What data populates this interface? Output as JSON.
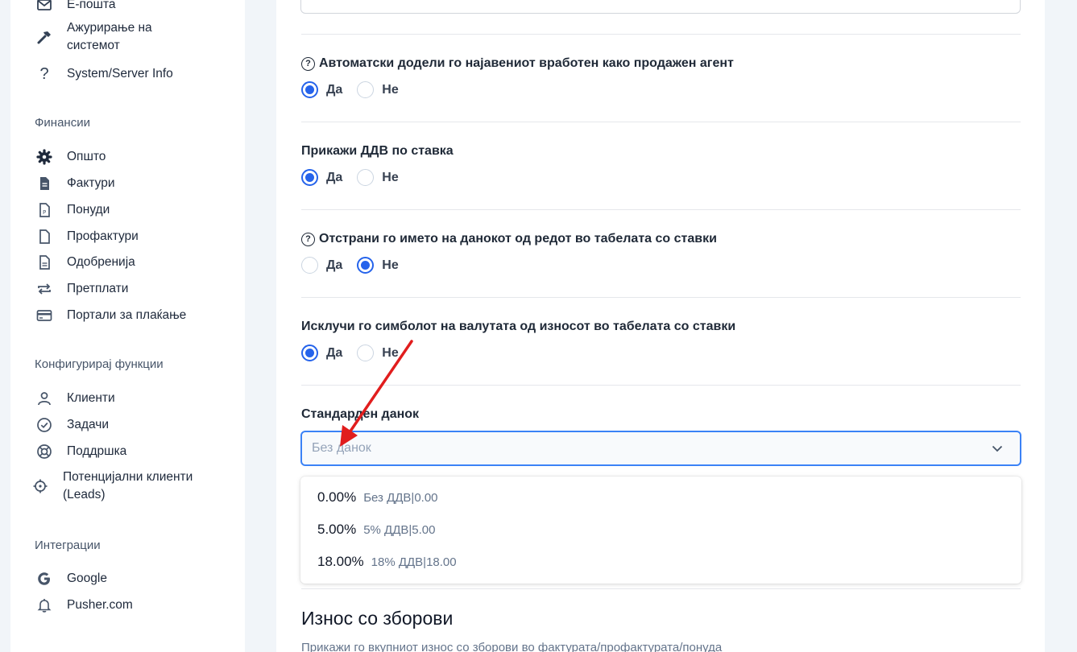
{
  "sidebar": {
    "items_top": [
      {
        "label": "Е-пошта",
        "icon": "mail-icon"
      },
      {
        "label": "Ажурирање на системот",
        "icon": "hammer-icon"
      },
      {
        "label": "System/Server Info",
        "icon": "question-icon"
      }
    ],
    "finance_heading": "Финансии",
    "finance_items": [
      {
        "label": "Општо",
        "icon": "gear-icon"
      },
      {
        "label": "Фактури",
        "icon": "invoice-icon"
      },
      {
        "label": "Понуди",
        "icon": "estimate-icon"
      },
      {
        "label": "Профактури",
        "icon": "file-icon"
      },
      {
        "label": "Одобренија",
        "icon": "file-lines-icon"
      },
      {
        "label": "Претплати",
        "icon": "repeat-icon"
      },
      {
        "label": "Портали за плаќање",
        "icon": "credit-card-icon"
      }
    ],
    "features_heading": "Конфигурирај функции",
    "features_items": [
      {
        "label": "Клиенти",
        "icon": "user-icon"
      },
      {
        "label": "Задачи",
        "icon": "check-circle-icon"
      },
      {
        "label": "Поддршка",
        "icon": "life-ring-icon"
      },
      {
        "label": "Потенцијални клиенти (Leads)",
        "icon": "crosshair-icon"
      }
    ],
    "integrations_heading": "Интеграции",
    "integrations_items": [
      {
        "label": "Google",
        "icon": "google-icon"
      },
      {
        "label": "Pusher.com",
        "icon": "bell-icon"
      }
    ]
  },
  "settings": [
    {
      "label": "Автоматски додели го најавениот вработен како продажен агент",
      "help": true,
      "yes": "Да",
      "no": "Не",
      "selected": "yes"
    },
    {
      "label": "Прикажи ДДВ по ставка",
      "help": false,
      "yes": "Да",
      "no": "Не",
      "selected": "yes"
    },
    {
      "label": "Отстрани го името на данокот од редот во табелата со ставки",
      "help": true,
      "yes": "Да",
      "no": "Не",
      "selected": "no"
    },
    {
      "label": "Исклучи го симболот на валутата од износот во табелата со ставки",
      "help": false,
      "yes": "Да",
      "no": "Не",
      "selected": "yes"
    }
  ],
  "default_tax": {
    "label": "Стандарден данок",
    "placeholder": "Без данок",
    "options": [
      {
        "rate": "0.00%",
        "detail": "Без ДДВ|0.00"
      },
      {
        "rate": "5.00%",
        "detail": "5% ДДВ|5.00"
      },
      {
        "rate": "18.00%",
        "detail": "18% ДДВ|18.00"
      }
    ]
  },
  "amount_words": {
    "title": "Износ со зборови",
    "description": "Прикажи го вкупниот износ со зборови во фактурата/профактурата/понуда"
  },
  "colors": {
    "accent": "#2563eb",
    "annotation_arrow": "#e11d1d"
  }
}
